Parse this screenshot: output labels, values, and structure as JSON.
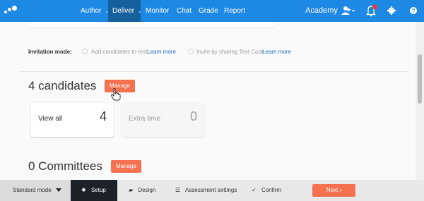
{
  "nav": {
    "items": [
      {
        "label": "Author",
        "caret": "⌄"
      },
      {
        "label": "Deliver",
        "caret": "⌄"
      },
      {
        "label": "Monitor"
      },
      {
        "label": "Chat"
      },
      {
        "label": "Grade"
      },
      {
        "label": "Report"
      }
    ],
    "org": "Academy",
    "accent": "#1e88e5",
    "active_bg": "#17609e"
  },
  "invitation": {
    "label": "Invitation mode:",
    "option1": "Add candidates to test",
    "option2": "Invite by sharing Test Code",
    "learn_more": "Learn more"
  },
  "candidates": {
    "title": "4 candidates",
    "manage": "Manage",
    "cards": [
      {
        "label": "View all",
        "value": "4"
      },
      {
        "label": "Extra time",
        "value": "0"
      }
    ]
  },
  "committees": {
    "title": "0 Committees",
    "manage": "Manage"
  },
  "bottombar": {
    "mode": "Standard mode",
    "steps": [
      "Setup",
      "Design",
      "Assessment settings",
      "Confirm"
    ],
    "next": "Next"
  },
  "icons": {
    "logo": "logo-icon",
    "user": "user-add-icon",
    "bell": "bell-icon",
    "gear": "gear-icon",
    "help": "help-icon",
    "cursor": "hand-cursor-icon"
  }
}
